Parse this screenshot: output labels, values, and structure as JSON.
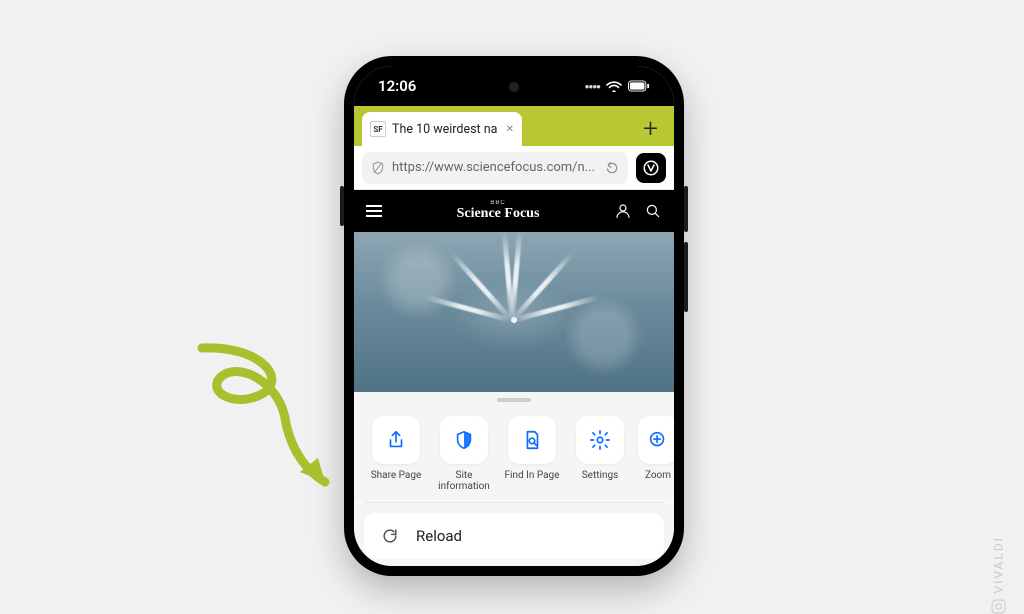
{
  "status": {
    "time": "12:06"
  },
  "tab": {
    "favicon_label": "SF",
    "title": "The 10 weirdest na"
  },
  "address": {
    "url": "https://www.sciencefocus.com/n..."
  },
  "site": {
    "brand_small": "BBC",
    "brand": "Science Focus"
  },
  "actions": {
    "share": {
      "label": "Share Page"
    },
    "siteinfo": {
      "label": "Site information"
    },
    "find": {
      "label": "Find In Page"
    },
    "settings": {
      "label": "Settings"
    },
    "zoom": {
      "label": "Zoom"
    }
  },
  "menu": {
    "reload": "Reload"
  },
  "watermark": "VIVALDI"
}
